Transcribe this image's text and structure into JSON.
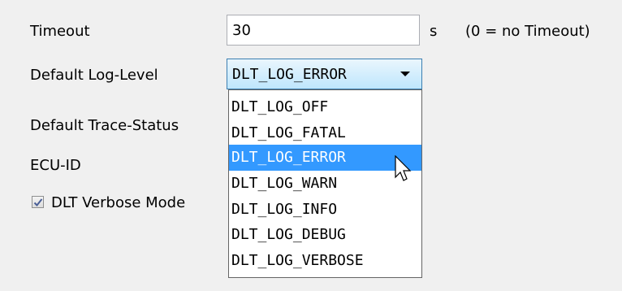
{
  "form": {
    "timeout_label": "Timeout",
    "timeout_value": "30",
    "timeout_unit": "s",
    "timeout_hint": "(0 = no Timeout)",
    "log_level_label": "Default Log-Level",
    "log_level_value": "DLT_LOG_ERROR",
    "trace_status_label": "Default Trace-Status",
    "ecu_id_label": "ECU-ID",
    "verbose_label": "DLT Verbose Mode",
    "verbose_checked": true
  },
  "dropdown": {
    "options": [
      "DLT_LOG_OFF",
      "DLT_LOG_FATAL",
      "DLT_LOG_ERROR",
      "DLT_LOG_WARN",
      "DLT_LOG_INFO",
      "DLT_LOG_DEBUG",
      "DLT_LOG_VERBOSE"
    ],
    "selected": "DLT_LOG_ERROR"
  },
  "colors": {
    "highlight": "#3399ff",
    "panel_bg": "#f0f0f0"
  }
}
